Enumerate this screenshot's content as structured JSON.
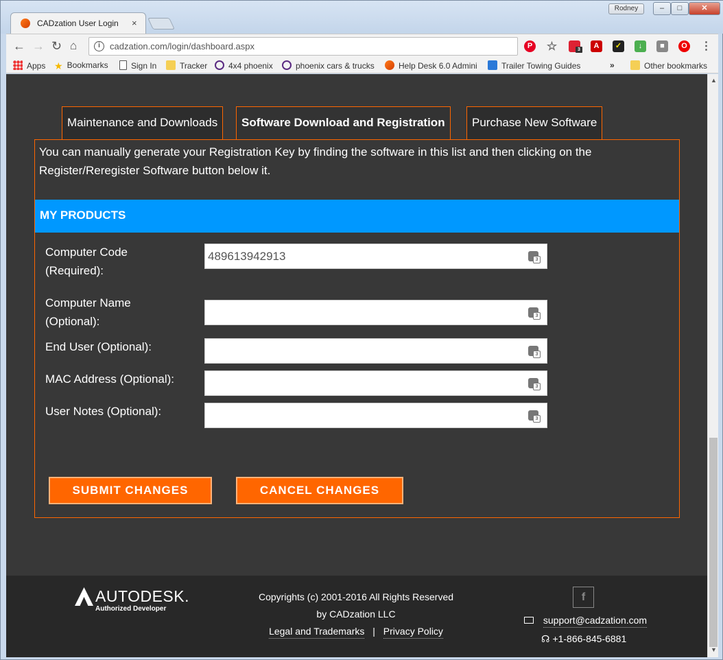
{
  "browser": {
    "tab_title": "CADzation User Login",
    "tab_close": "×",
    "profile_name": "Rodney",
    "window_min": "–",
    "window_max": "□",
    "window_close": "✕",
    "url": "cadzation.com/login/dashboard.aspx",
    "ext_badge": "3",
    "bookmarks": [
      {
        "label": "Apps",
        "icon": "apps-icon"
      },
      {
        "label": "Bookmarks",
        "icon": "star-icon"
      },
      {
        "label": "Sign In",
        "icon": "page-icon"
      },
      {
        "label": "Tracker",
        "icon": "folder-icon"
      },
      {
        "label": "4x4 phoenix",
        "icon": "peace-icon"
      },
      {
        "label": "phoenix cars & trucks",
        "icon": "peace-icon"
      },
      {
        "label": "Help Desk 6.0 Admini",
        "icon": "cadzation-icon"
      },
      {
        "label": "Trailer Towing Guides",
        "icon": "trailer-icon"
      }
    ],
    "more_bookmarks": "»",
    "other_bookmarks": "Other bookmarks"
  },
  "tabs": [
    {
      "label": "Maintenance and Downloads",
      "active": false
    },
    {
      "label": "Software Download and Registration",
      "active": true
    },
    {
      "label": "Purchase New Software",
      "active": false
    }
  ],
  "intro_text": "You can manually generate your Registration Key by finding the software in this list and then clicking on the Register/Reregister Software button below it.",
  "section_header": "MY PRODUCTS",
  "form": {
    "computer_code": {
      "label_line1": "Computer Code",
      "label_line2": "(Required):",
      "value": "489613942913"
    },
    "computer_name": {
      "label_line1": "Computer Name",
      "label_line2": "(Optional):",
      "value": ""
    },
    "end_user": {
      "label": "End User (Optional):",
      "value": ""
    },
    "mac_address": {
      "label": "MAC Address (Optional):",
      "value": ""
    },
    "user_notes": {
      "label": "User Notes (Optional):",
      "value": ""
    }
  },
  "buttons": {
    "submit": "SUBMIT CHANGES",
    "cancel": "CANCEL CHANGES"
  },
  "footer": {
    "brand": "AUTODESK.",
    "brand_sub": "Authorized Developer",
    "copyright_line1": "Copyrights (c) 2001-2016 All Rights Reserved",
    "copyright_line2": "by CADzation LLC",
    "legal_link": "Legal and Trademarks",
    "separator": "|",
    "privacy_link": "Privacy Policy",
    "facebook": "f",
    "email": "support@cadzation.com",
    "phone": "+1-866-845-6881"
  },
  "colors": {
    "accent_orange": "#ff6600",
    "header_blue": "#0098ff",
    "page_bg": "#383838",
    "footer_bg": "#282828"
  }
}
